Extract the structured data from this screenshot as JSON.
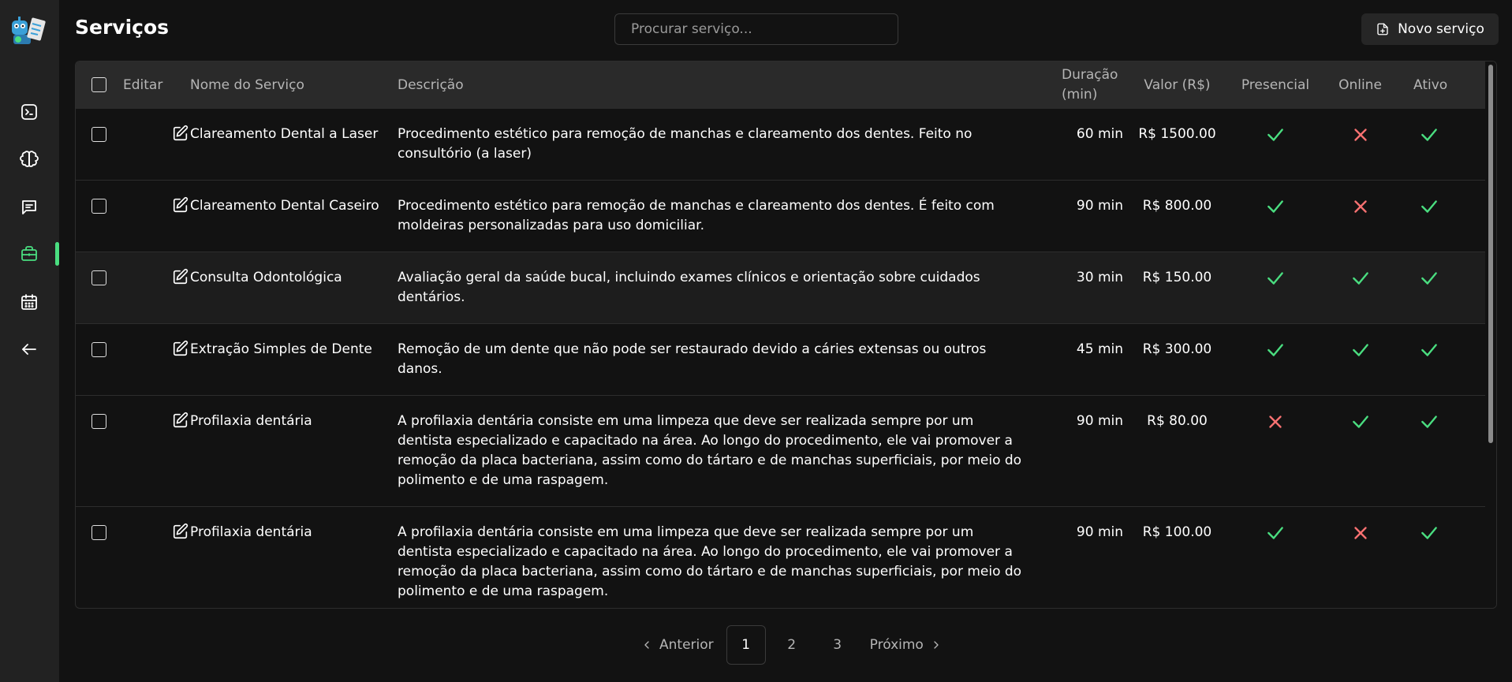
{
  "app": {
    "title": "Serviços"
  },
  "search": {
    "placeholder": "Procurar serviço..."
  },
  "toolbar": {
    "new_label": "Novo serviço"
  },
  "sidebar": {
    "items": [
      {
        "icon": "terminal-icon"
      },
      {
        "icon": "brain-icon"
      },
      {
        "icon": "chat-icon"
      },
      {
        "icon": "briefcase-icon",
        "active": true
      },
      {
        "icon": "calendar-icon"
      },
      {
        "icon": "arrow-left-icon"
      }
    ],
    "accent": "#4ade80"
  },
  "table": {
    "columns": {
      "edit": "Editar",
      "name": "Nome do Serviço",
      "description": "Descrição",
      "duration": "Duração (min)",
      "price": "Valor (R$)",
      "presencial": "Presencial",
      "online": "Online",
      "active": "Ativo"
    },
    "rows": [
      {
        "name": "Clareamento Dental a Laser",
        "description": "Procedimento estético para remoção de manchas e clareamento dos dentes. Feito no consultório (a laser)",
        "duration": "60 min",
        "price": "R$ 1500.00",
        "presencial": true,
        "online": false,
        "active": true
      },
      {
        "name": "Clareamento Dental Caseiro",
        "description": "Procedimento estético para remoção de manchas e clareamento dos dentes. É feito com moldeiras personalizadas para uso domiciliar.",
        "duration": "90 min",
        "price": "R$ 800.00",
        "presencial": true,
        "online": false,
        "active": true
      },
      {
        "name": "Consulta Odontológica",
        "description": "Avaliação geral da saúde bucal, incluindo exames clínicos e orientação sobre cuidados dentários.",
        "duration": "30 min",
        "price": "R$ 150.00",
        "presencial": true,
        "online": true,
        "active": true
      },
      {
        "name": "Extração Simples de Dente",
        "description": "Remoção de um dente que não pode ser restaurado devido a cáries extensas ou outros danos.",
        "duration": "45 min",
        "price": "R$ 300.00",
        "presencial": true,
        "online": true,
        "active": true
      },
      {
        "name": "Profilaxia dentária",
        "description": "A profilaxia dentária consiste em uma limpeza que deve ser realizada sempre por um dentista especializado e capacitado na área. Ao longo do procedimento, ele vai promover a remoção da placa bacteriana, assim como do tártaro e de manchas superficiais, por meio do polimento e de uma raspagem.",
        "duration": "90 min",
        "price": "R$ 80.00",
        "presencial": false,
        "online": true,
        "active": true
      },
      {
        "name": "Profilaxia dentária",
        "description": "A profilaxia dentária consiste em uma limpeza que deve ser realizada sempre por um dentista especializado e capacitado na área. Ao longo do procedimento, ele vai promover a remoção da placa bacteriana, assim como do tártaro e de manchas superficiais, por meio do polimento e de uma raspagem.",
        "duration": "90 min",
        "price": "R$ 100.00",
        "presencial": true,
        "online": false,
        "active": true
      }
    ],
    "colors": {
      "check": "#4ade80",
      "cross": "#f87171"
    }
  },
  "pagination": {
    "prev_label": "Anterior",
    "next_label": "Próximo",
    "pages": [
      "1",
      "2",
      "3"
    ],
    "current": "1"
  }
}
